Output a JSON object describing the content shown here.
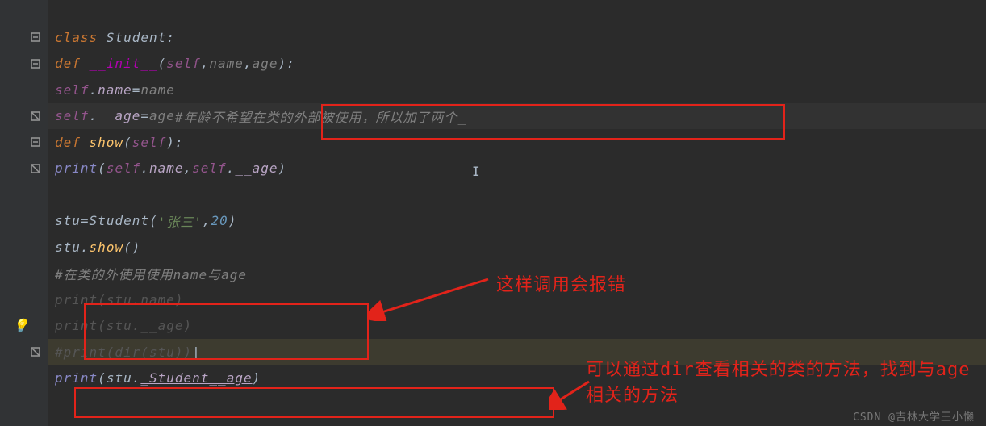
{
  "code": {
    "line1": {
      "kw1": "class ",
      "cls": "Student",
      "colon": ":"
    },
    "line2": {
      "kw1": "def ",
      "fn": "__init__",
      "paren1": "(",
      "self": "self",
      "c1": ",",
      "p1": "name",
      "c2": ",",
      "p2": "age",
      "paren2": ")",
      "colon": ":"
    },
    "line3": {
      "self": "self",
      "dot": ".",
      "attr": "name",
      "eq": "=",
      "param": "name"
    },
    "line4": {
      "self": "self",
      "dot": ".",
      "attr": "__age",
      "eq": "=",
      "param": "age"
    },
    "line4c": "#年龄不希望在类的外部被使用，所以加了两个_",
    "line5": {
      "kw1": "def ",
      "fn": "show",
      "paren1": "(",
      "self": "self",
      "paren2": ")",
      "colon": ":"
    },
    "line6": {
      "fn": "print",
      "paren1": "(",
      "self1": "self",
      "dot1": ".",
      "attr1": "name",
      "c": ",",
      "self2": "self",
      "dot2": ".",
      "attr2": "__age",
      "paren2": ")"
    },
    "line8": {
      "var": "stu",
      "eq": "=",
      "cls": "Student",
      "paren1": "(",
      "str": "'张三'",
      "c": ",",
      "num": "20",
      "paren2": ")"
    },
    "line9": {
      "var": "stu",
      "dot": ".",
      "fn": "show",
      "parens": "()"
    },
    "line10": "#在类的外使用使用name与age",
    "line11": "print(stu.name)",
    "line12": "print(stu.__age)",
    "line13": {
      "pre": "#print(dir(stu))",
      "cursor": "|"
    },
    "line14": {
      "fn": "print",
      "paren1": "(",
      "var": "stu",
      "dot": ".",
      "attr": "_Student__age",
      "paren2": ")"
    }
  },
  "annotations": {
    "text1": "这样调用会报错",
    "text2": "可以通过dir查看相关的类的方法，找到与age相关的方法"
  },
  "watermark": "CSDN @吉林大学王小懒",
  "icons": {
    "fold_collapse": "collapse-icon",
    "fold_expand": "expand-icon",
    "bulb": "bulb-icon"
  }
}
